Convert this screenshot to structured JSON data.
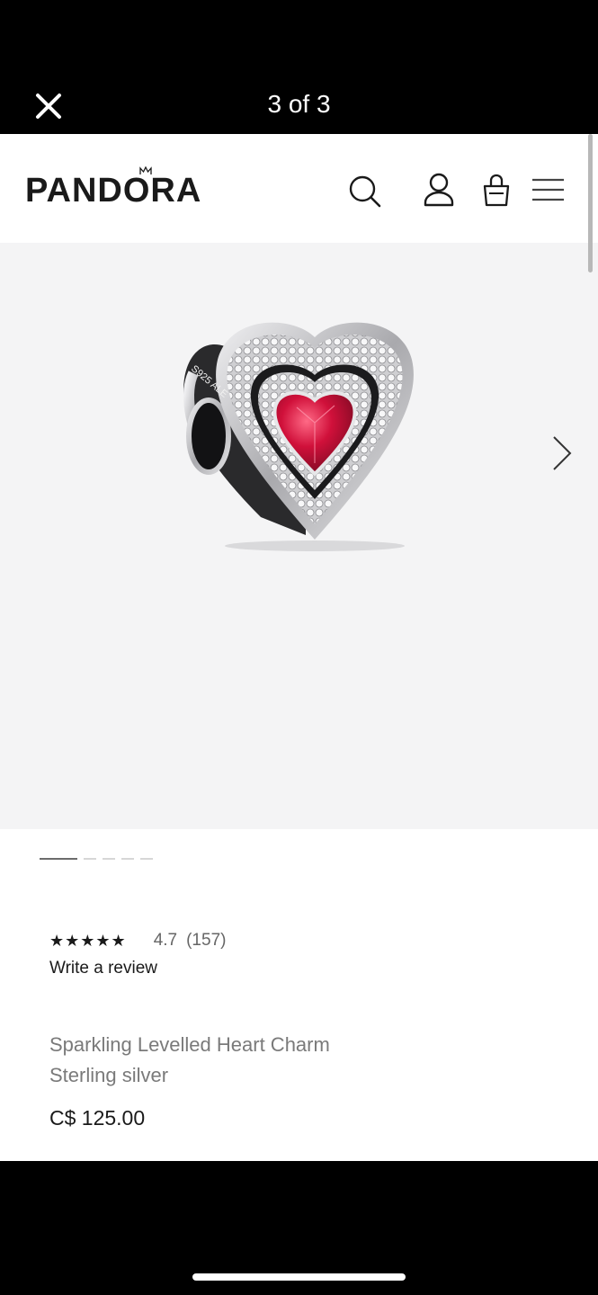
{
  "viewer": {
    "counter": "3 of 3",
    "close_icon": "close-icon"
  },
  "header": {
    "brand": "PANDORA",
    "icons": [
      "search-icon",
      "account-icon",
      "bag-icon",
      "menu-icon"
    ]
  },
  "gallery": {
    "image": "sparkling-red-heart-charm",
    "next_icon": "chevron-right-icon",
    "pager": {
      "total": 5,
      "active": 1
    }
  },
  "product": {
    "stars": "★★★★★",
    "rating": "4.7",
    "review_count": "(157)",
    "write_review": "Write a review",
    "name": "Sparkling Levelled Heart Charm",
    "material": "Sterling silver",
    "price": "C$ 125.00"
  },
  "colors": {
    "gem": "#c8102e",
    "silver": "#c9c9cc",
    "gallery_bg": "#f4f4f5"
  }
}
